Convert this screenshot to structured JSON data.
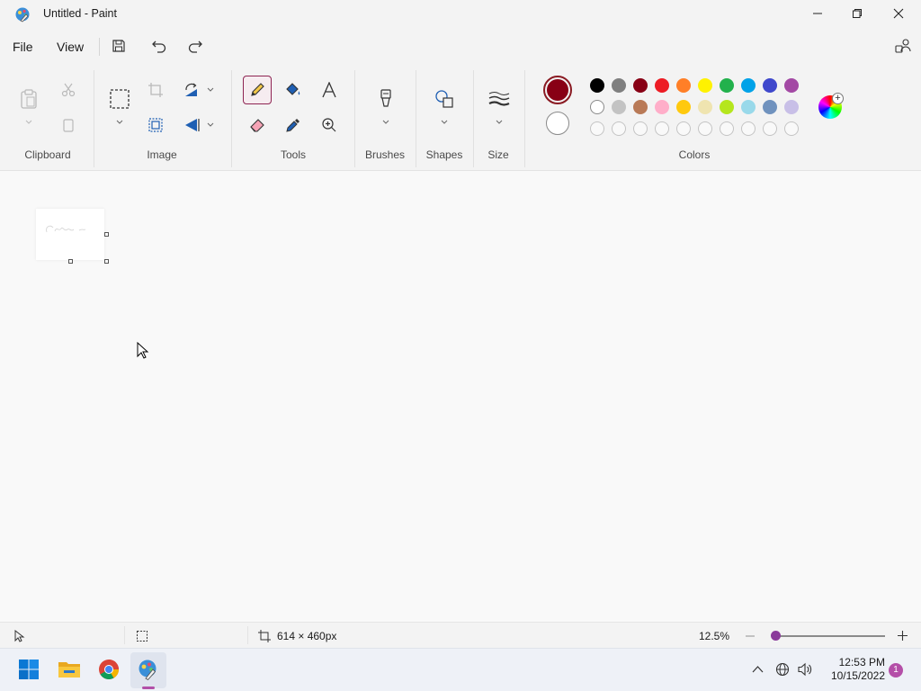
{
  "window": {
    "title": "Untitled - Paint"
  },
  "menu": {
    "file": "File",
    "view": "View"
  },
  "ribbon": {
    "groups": {
      "clipboard": "Clipboard",
      "image": "Image",
      "tools": "Tools",
      "brushes": "Brushes",
      "shapes": "Shapes",
      "size": "Size",
      "colors": "Colors"
    },
    "selected_tool": "pencil"
  },
  "colors": {
    "primary": "#880015",
    "secondary": "#ffffff",
    "palette_row1": [
      "#000000",
      "#7f7f7f",
      "#880015",
      "#ed1c24",
      "#ff7f27",
      "#fff200",
      "#22b14c",
      "#00a2e8",
      "#3f48cc",
      "#a349a4"
    ],
    "palette_row2": [
      "#ffffff",
      "#c3c3c3",
      "#b97a57",
      "#ffaec9",
      "#ffc90e",
      "#efe4b0",
      "#b5e61d",
      "#99d9ea",
      "#7092be",
      "#c8bfe7"
    ],
    "palette_row3_count_empty": "10"
  },
  "status": {
    "canvas_size": "614 × 460px",
    "zoom": "12.5%",
    "zoom_level": 0.05
  },
  "taskbar": {
    "time": "12:53 PM",
    "date": "10/15/2022",
    "notification_count": "1"
  },
  "accent": "#8e2452"
}
